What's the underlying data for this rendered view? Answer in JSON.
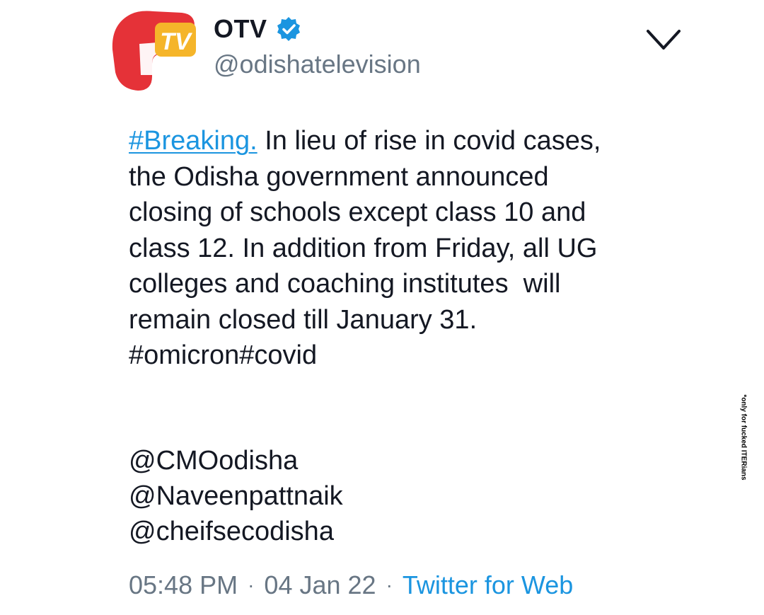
{
  "account": {
    "display_name": "OTV",
    "handle": "@odishatelevision",
    "verified": true,
    "logo_text": "TV"
  },
  "tweet": {
    "lines": [
      {
        "link": "#Breaking.",
        "text": " In lieu of rise in covid cases,"
      },
      {
        "text": "the Odisha government announced"
      },
      {
        "text": "closing of schools except class 10 and"
      },
      {
        "text": "class 12. In addition from Friday, all UG"
      },
      {
        "text": "colleges and coaching institutes  will"
      },
      {
        "text": "remain closed till January 31."
      },
      {
        "text": "#omicron#covid"
      }
    ],
    "mentions": [
      "@CMOodisha",
      "@Naveenpattnaik",
      "@cheifsecodisha"
    ]
  },
  "meta": {
    "time": "05:48 PM",
    "date": "04 Jan 22",
    "separator": "·",
    "source": "Twitter for Web"
  },
  "watermark": "*only for fucked ITERians",
  "colors": {
    "link": "#1b95e0",
    "secondary_text": "#687684",
    "text": "#141823",
    "logo_red": "#e53238",
    "logo_yellow": "#f5b52a"
  },
  "icons": {
    "verified": "verified-badge-icon",
    "menu": "chevron-down-icon"
  }
}
